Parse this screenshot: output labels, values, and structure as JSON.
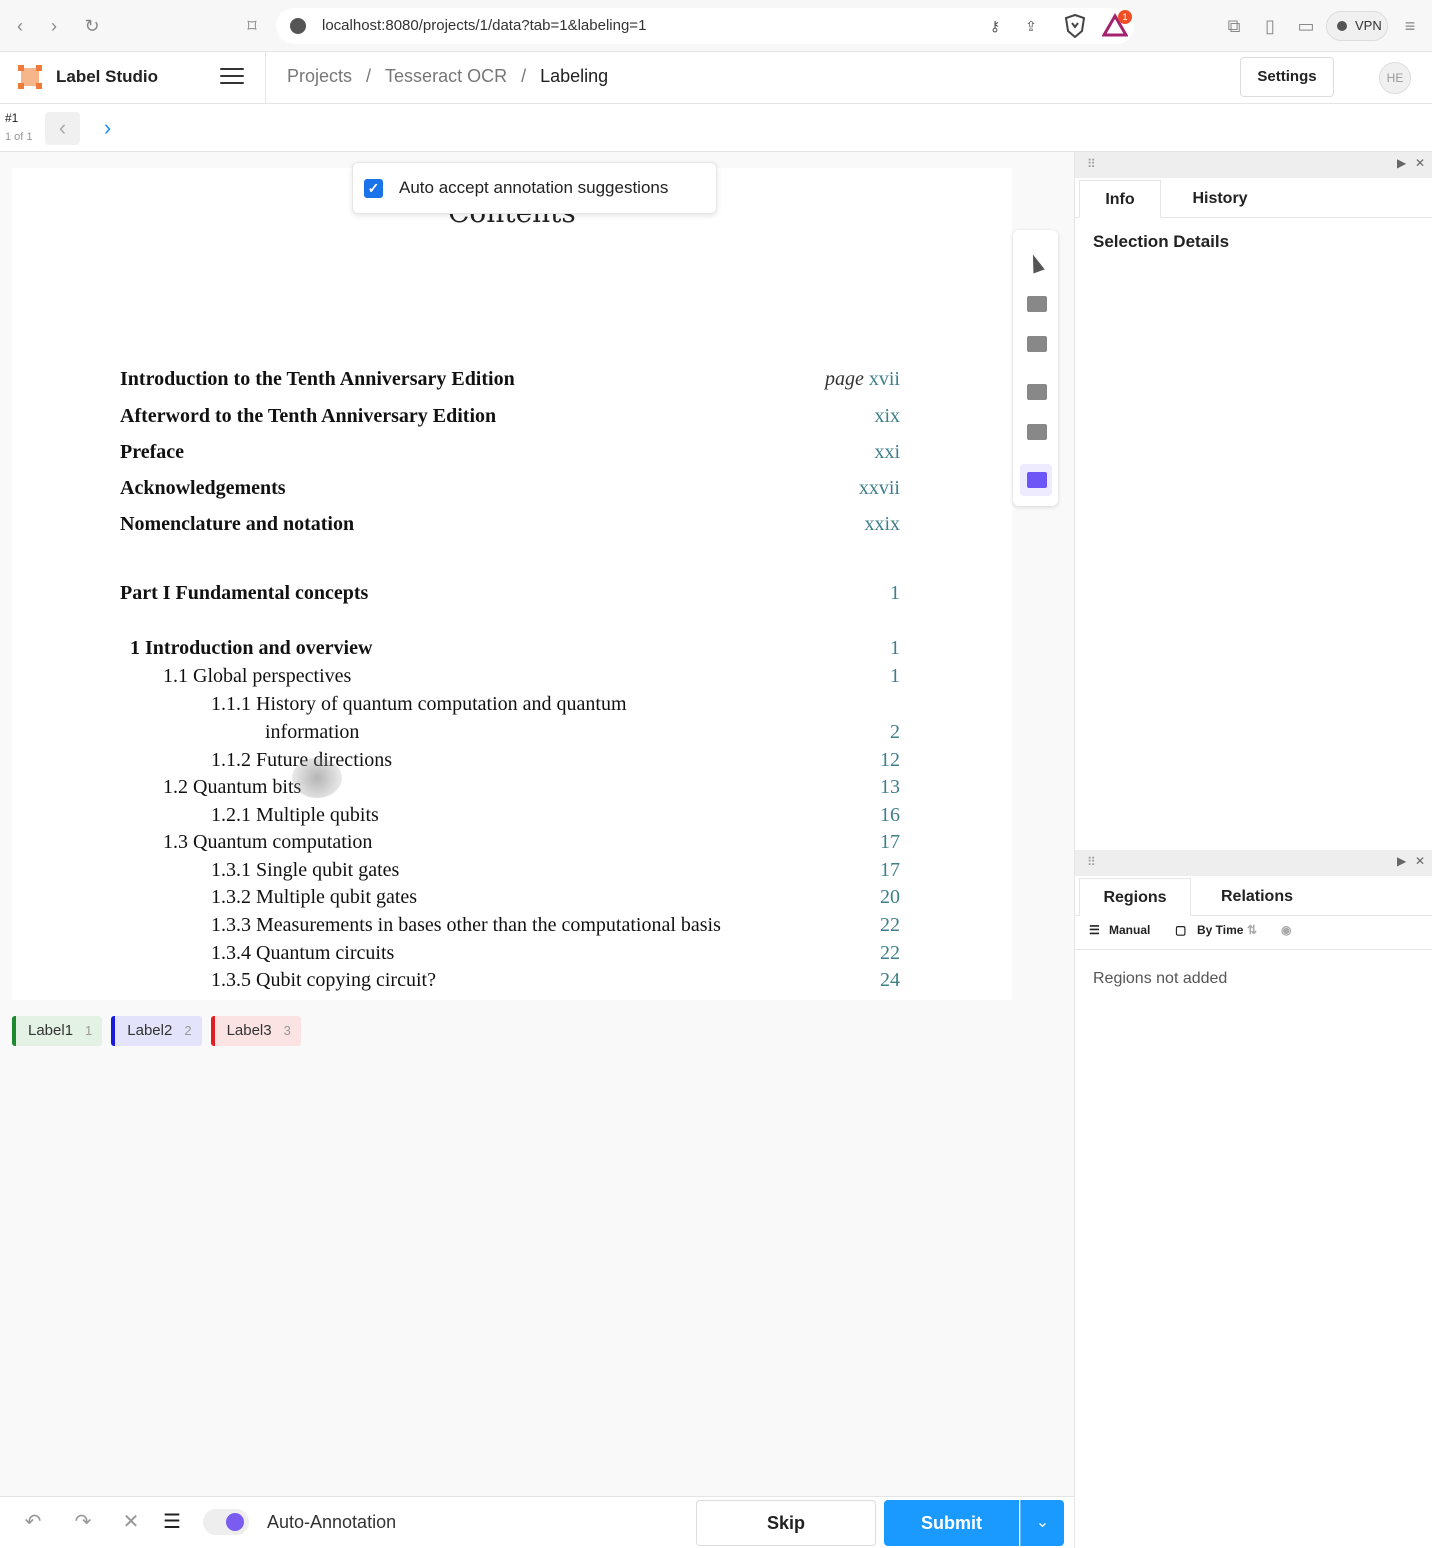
{
  "browser": {
    "url": "localhost:8080/projects/1/data?tab=1&labeling=1",
    "vpn_label": "VPN",
    "badge_count": "1"
  },
  "header": {
    "app_name": "Label Studio",
    "breadcrumb": [
      "Projects",
      "Tesseract OCR",
      "Labeling"
    ],
    "separator": "/",
    "settings_label": "Settings",
    "avatar_initials": "HE"
  },
  "task_nav": {
    "id": "#1",
    "count": "1 of 1"
  },
  "auto_accept": {
    "label": "Auto accept annotation suggestions",
    "checked": true
  },
  "document": {
    "title": "Contents",
    "page_word": "page",
    "entries": [
      {
        "text": "Introduction to the Tenth Anniversary Edition",
        "page": "xvii"
      },
      {
        "text": "Afterword to the Tenth Anniversary Edition",
        "page": "xix"
      },
      {
        "text": "Preface",
        "page": "xxi"
      },
      {
        "text": "Acknowledgements",
        "page": "xxvii"
      },
      {
        "text": "Nomenclature and notation",
        "page": "xxix"
      },
      {
        "text": "Part I  Fundamental concepts",
        "page": "1"
      },
      {
        "text": "1  Introduction and overview",
        "page": "1"
      },
      {
        "text": "1.1  Global perspectives",
        "page": "1"
      },
      {
        "text": "1.1.1  History of quantum computation and quantum",
        "page": ""
      },
      {
        "text": "information",
        "page": "2"
      },
      {
        "text": "1.1.2  Future directions",
        "page": "12"
      },
      {
        "text": "1.2  Quantum bits",
        "page": "13"
      },
      {
        "text": "1.2.1  Multiple qubits",
        "page": "16"
      },
      {
        "text": "1.3  Quantum computation",
        "page": "17"
      },
      {
        "text": "1.3.1  Single qubit gates",
        "page": "17"
      },
      {
        "text": "1.3.2  Multiple qubit gates",
        "page": "20"
      },
      {
        "text": "1.3.3  Measurements in bases other than the computational basis",
        "page": "22"
      },
      {
        "text": "1.3.4  Quantum circuits",
        "page": "22"
      },
      {
        "text": "1.3.5  Qubit copying circuit?",
        "page": "24"
      }
    ]
  },
  "labels": [
    {
      "name": "Label1",
      "hotkey": "1",
      "color": "#1e8a2e",
      "bg": "#e3f2e4"
    },
    {
      "name": "Label2",
      "hotkey": "2",
      "color": "#1a1adb",
      "bg": "#e3e3fb"
    },
    {
      "name": "Label3",
      "hotkey": "3",
      "color": "#e02020",
      "bg": "#fbe3e3"
    }
  ],
  "bottom": {
    "auto_annotation": "Auto-Annotation",
    "skip": "Skip",
    "submit": "Submit"
  },
  "side": {
    "tabs_top": [
      "Info",
      "History"
    ],
    "selection_details": "Selection Details",
    "tabs_bottom": [
      "Regions",
      "Relations"
    ],
    "sort_manual": "Manual",
    "sort_by_time": "By Time",
    "regions_empty": "Regions not added"
  }
}
